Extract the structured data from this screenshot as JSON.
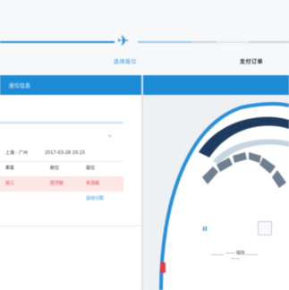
{
  "progress": {
    "plane_icon": "airplane-icon",
    "current_step": "选择座位",
    "next_step": "支付订单"
  },
  "section": {
    "title": "座位信息"
  },
  "card": {
    "chevron_icon": "chevron-down-icon",
    "rows": [
      {
        "c1": "上海 - 广州",
        "c2": "2017-03-28 20:15",
        "c3": ""
      },
      {
        "c1": "乘客",
        "c2": "舱位",
        "c3": "座位"
      },
      {
        "c1": "张三",
        "c2": "经济舱",
        "c3": "未选座"
      },
      {
        "c1": "",
        "c2": "",
        "c3": "自动分配"
      }
    ]
  },
  "seatmap": {
    "pause_label": "II",
    "zoom_label": "—— 缩放 ——"
  },
  "colors": {
    "accent": "#1d8bd6",
    "warning": "#e0474c"
  }
}
